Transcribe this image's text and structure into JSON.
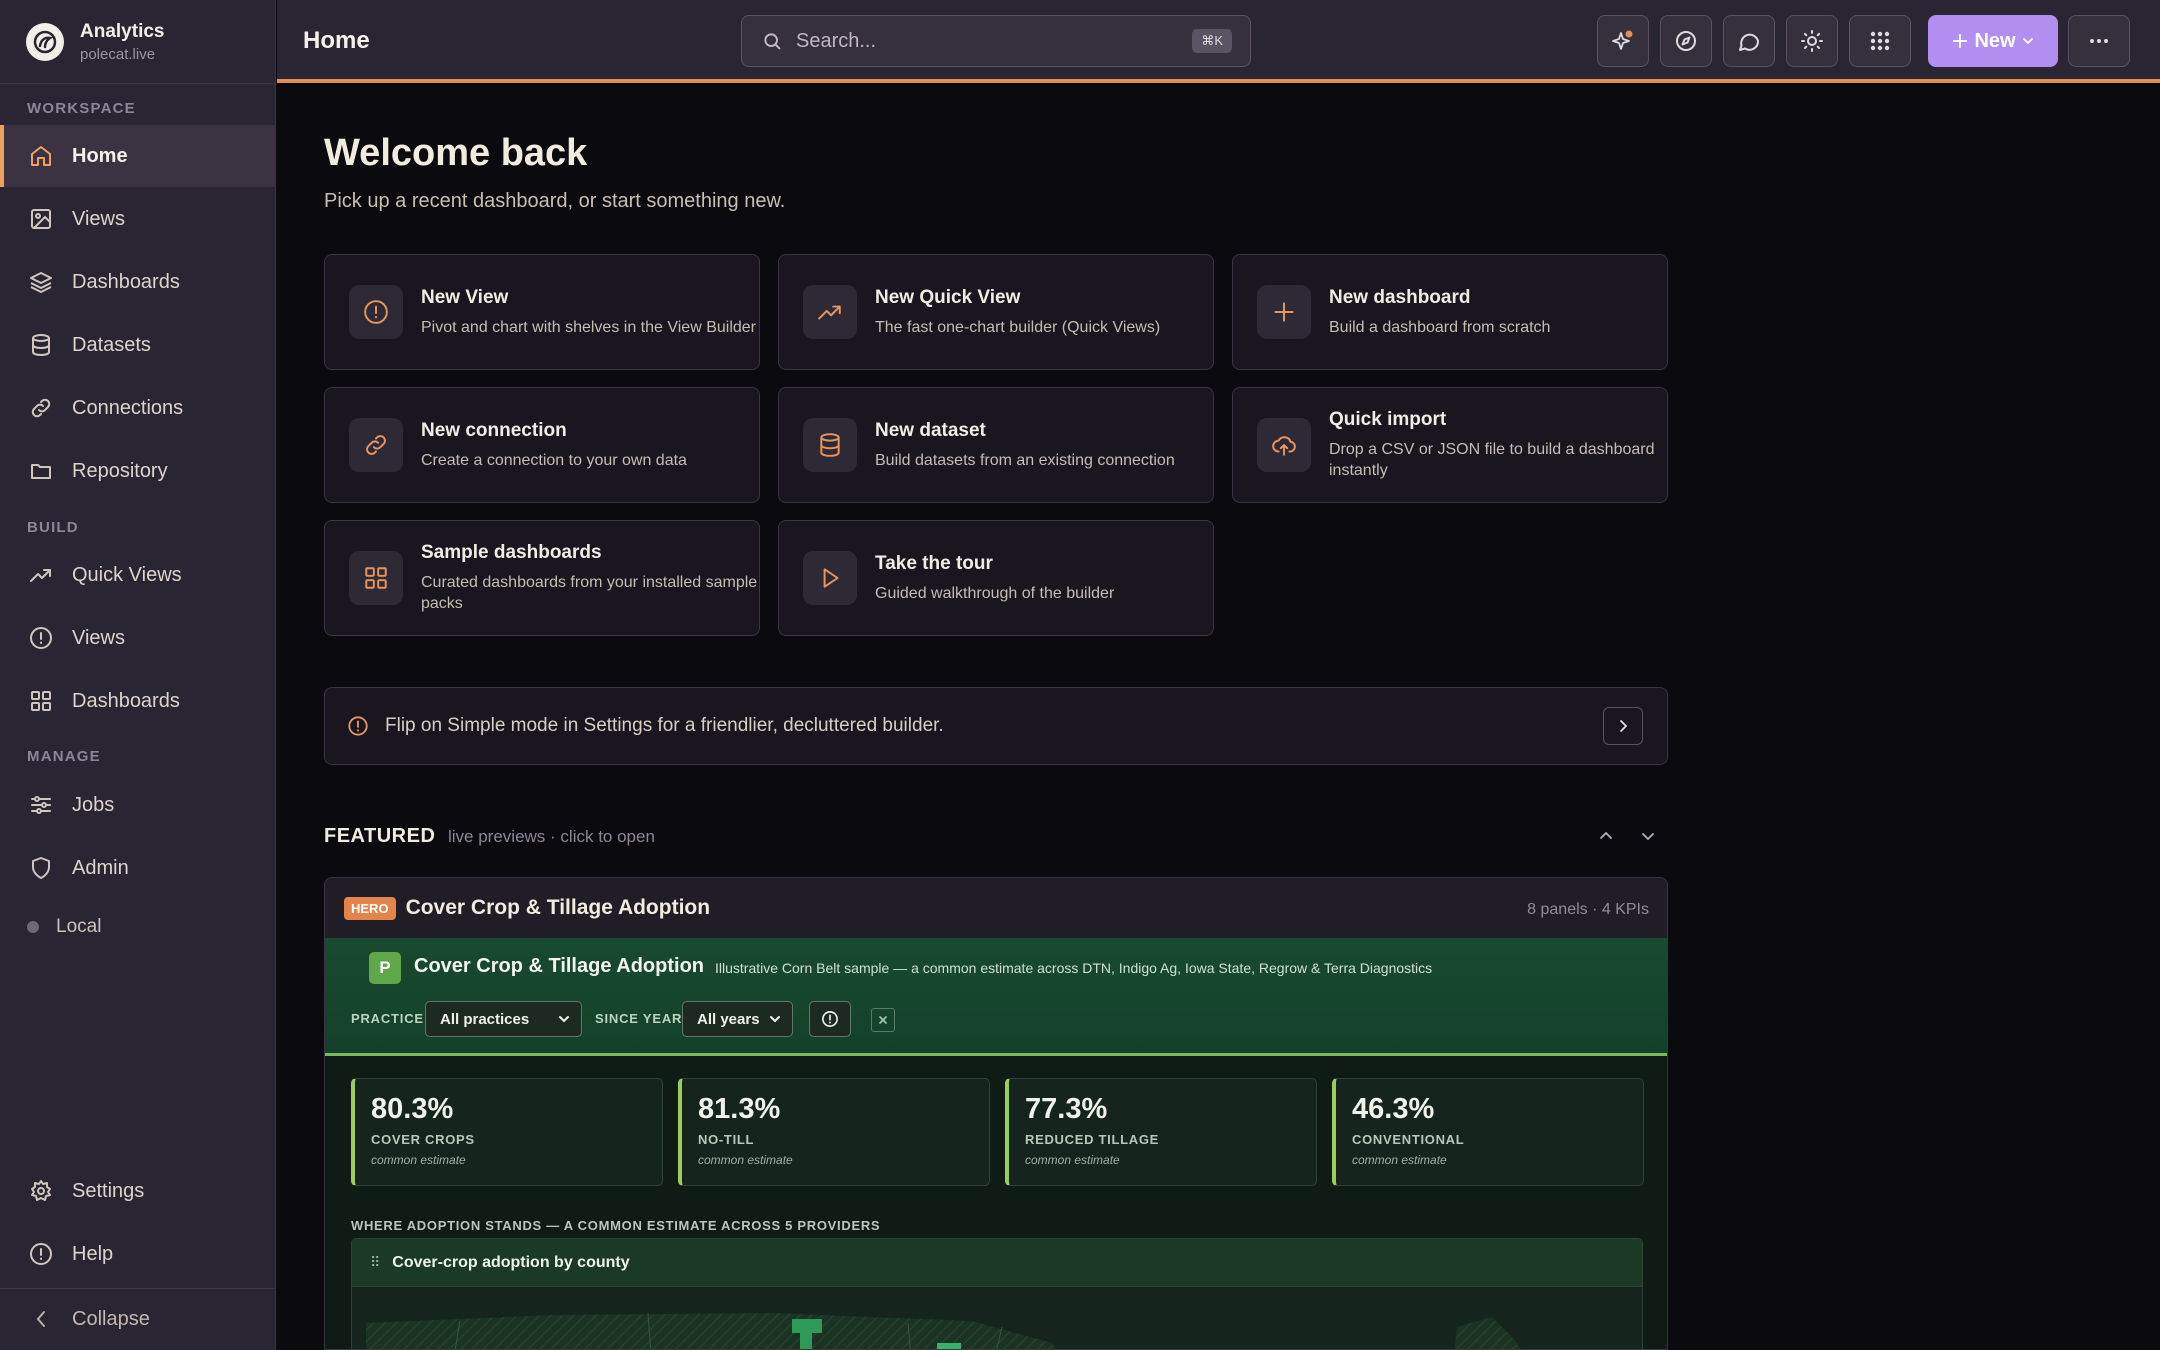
{
  "brand": {
    "title": "Analytics",
    "subtitle": "polecat.live"
  },
  "sidebar": {
    "sections": {
      "workspace": "WORKSPACE",
      "build": "BUILD",
      "manage": "MANAGE"
    },
    "items": [
      {
        "label": "Home",
        "icon": "home-icon"
      },
      {
        "label": "Views",
        "icon": "image-icon"
      },
      {
        "label": "Dashboards",
        "icon": "layers-icon"
      },
      {
        "label": "Datasets",
        "icon": "database-icon"
      },
      {
        "label": "Connections",
        "icon": "link-icon"
      },
      {
        "label": "Repository",
        "icon": "folder-icon"
      },
      {
        "label": "Quick Views",
        "icon": "trending-icon"
      },
      {
        "label": "Views",
        "icon": "alert-circle-icon"
      },
      {
        "label": "Dashboards",
        "icon": "grid-icon"
      },
      {
        "label": "Jobs",
        "icon": "sliders-icon"
      },
      {
        "label": "Admin",
        "icon": "shield-icon"
      }
    ],
    "local": "Local",
    "settings": "Settings",
    "help": "Help",
    "collapse": "Collapse"
  },
  "header": {
    "title": "Home",
    "search_placeholder": "Search...",
    "search_shortcut": "⌘K",
    "new_label": "New"
  },
  "main": {
    "welcome": "Welcome back",
    "subtitle": "Pick up a recent dashboard, or start something new.",
    "cards": [
      {
        "title": "New View",
        "desc": "Pivot and chart with shelves in the View Builder",
        "icon": "alert-circle-icon"
      },
      {
        "title": "New Quick View",
        "desc": "The fast one-chart builder (Quick Views)",
        "icon": "trending-icon"
      },
      {
        "title": "New dashboard",
        "desc": "Build a dashboard from scratch",
        "icon": "plus-icon"
      },
      {
        "title": "New connection",
        "desc": "Create a connection to your own data",
        "icon": "link-icon"
      },
      {
        "title": "New dataset",
        "desc": "Build datasets from an existing connection",
        "icon": "database-icon"
      },
      {
        "title": "Quick import",
        "desc": "Drop a CSV or JSON file to build a dashboard instantly",
        "icon": "upload-cloud-icon"
      },
      {
        "title": "Sample dashboards",
        "desc": "Curated dashboards from your installed sample packs",
        "icon": "grid-icon"
      },
      {
        "title": "Take the tour",
        "desc": "Guided walkthrough of the builder",
        "icon": "play-icon"
      }
    ],
    "tip": "Flip on Simple mode in Settings for a friendlier, decluttered builder.",
    "featured": {
      "label": "FEATURED",
      "sub": "live previews · click to open",
      "badge": "HERO",
      "title": "Cover Crop & Tillage Adoption",
      "meta": "8 panels · 4 KPIs",
      "preview": {
        "logo": "P",
        "title": "Cover Crop & Tillage Adoption",
        "desc": "Illustrative Corn Belt sample — a common estimate across DTN, Indigo Ag, Iowa State, Regrow & Terra Diagnostics",
        "filters": {
          "practice_label": "PRACTICE",
          "practice_value": "All practices",
          "since_label": "SINCE YEAR",
          "since_value": "All years"
        },
        "kpis": [
          {
            "value": "80.3%",
            "label": "COVER CROPS",
            "note": "common estimate"
          },
          {
            "value": "81.3%",
            "label": "NO-TILL",
            "note": "common estimate"
          },
          {
            "value": "77.3%",
            "label": "REDUCED TILLAGE",
            "note": "common estimate"
          },
          {
            "value": "46.3%",
            "label": "CONVENTIONAL",
            "note": "common estimate"
          }
        ],
        "section_label": "WHERE ADOPTION STANDS — A COMMON ESTIMATE ACROSS 5 PROVIDERS",
        "map_title": "Cover-crop adoption by county"
      }
    }
  },
  "colors": {
    "accent": "#e48f52",
    "new_button": "#b08ff0",
    "hero_badge": "#e4844a",
    "kpi_bar": "#9ccc5c"
  }
}
